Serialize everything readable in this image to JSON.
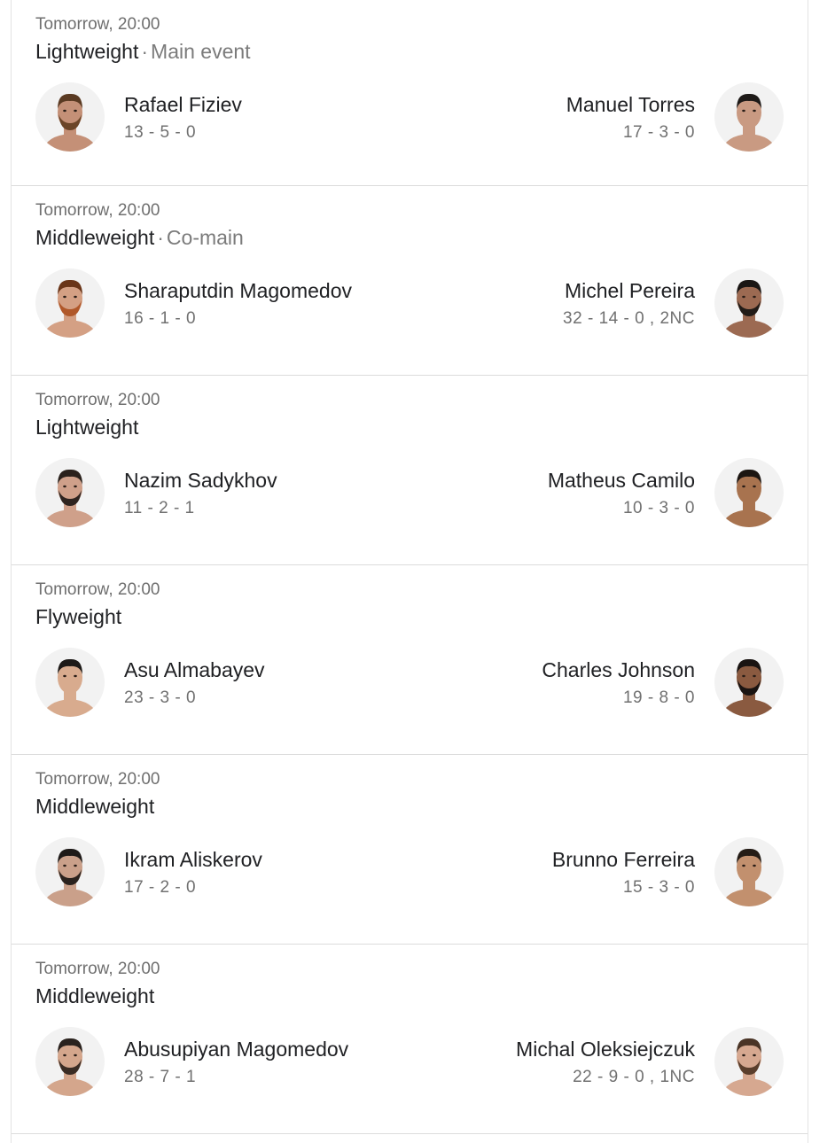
{
  "fights": [
    {
      "time": "Tomorrow, 20:00",
      "weight_class": "Lightweight",
      "billing": "Main event",
      "left": {
        "name": "Rafael Fiziev",
        "record": "13 - 5 - 0",
        "skin": "#c49077",
        "hair": "#5a3a22",
        "beard": "#6b4528"
      },
      "right": {
        "name": "Manuel Torres",
        "record": "17 - 3 - 0",
        "skin": "#c99a82",
        "hair": "#1e1a18",
        "beard": ""
      }
    },
    {
      "time": "Tomorrow, 20:00",
      "weight_class": "Middleweight",
      "billing": "Co-main",
      "left": {
        "name": "Sharaputdin Magomedov",
        "record": "16 - 1 - 0",
        "skin": "#d4a084",
        "hair": "#6a3518",
        "beard": "#b0582a"
      },
      "right": {
        "name": "Michel Pereira",
        "record": "32 - 14 - 0 , 2NC",
        "skin": "#9c6a52",
        "hair": "#1a1614",
        "beard": "#221c18"
      }
    },
    {
      "time": "Tomorrow, 20:00",
      "weight_class": "Lightweight",
      "billing": "",
      "left": {
        "name": "Nazim Sadykhov",
        "record": "11 - 2 - 1",
        "skin": "#cfa08a",
        "hair": "#2a211c",
        "beard": "#2e2420"
      },
      "right": {
        "name": "Matheus Camilo",
        "record": "10 - 3 - 0",
        "skin": "#a8734f",
        "hair": "#1c1612",
        "beard": ""
      }
    },
    {
      "time": "Tomorrow, 20:00",
      "weight_class": "Flyweight",
      "billing": "",
      "left": {
        "name": "Asu Almabayev",
        "record": "23 - 3 - 0",
        "skin": "#d8ab8e",
        "hair": "#1e1a18",
        "beard": ""
      },
      "right": {
        "name": "Charles Johnson",
        "record": "19 - 8 - 0",
        "skin": "#8a5a40",
        "hair": "#1a1412",
        "beard": "#1a1412"
      }
    },
    {
      "time": "Tomorrow, 20:00",
      "weight_class": "Middleweight",
      "billing": "",
      "left": {
        "name": "Ikram Aliskerov",
        "record": "17 - 2 - 0",
        "skin": "#caa08a",
        "hair": "#1e1a18",
        "beard": "#2a221e"
      },
      "right": {
        "name": "Brunno Ferreira",
        "record": "15 - 3 - 0",
        "skin": "#c2906e",
        "hair": "#241c16",
        "beard": ""
      }
    },
    {
      "time": "Tomorrow, 20:00",
      "weight_class": "Middleweight",
      "billing": "",
      "left": {
        "name": "Abusupiyan Magomedov",
        "record": "28 - 7 - 1",
        "skin": "#d4a68c",
        "hair": "#2a221e",
        "beard": "#3a2c24"
      },
      "right": {
        "name": "Michal Oleksiejczuk",
        "record": "22 - 9 - 0 , 1NC",
        "skin": "#d6a890",
        "hair": "#4a3426",
        "beard": "#5a3e2c"
      }
    }
  ]
}
